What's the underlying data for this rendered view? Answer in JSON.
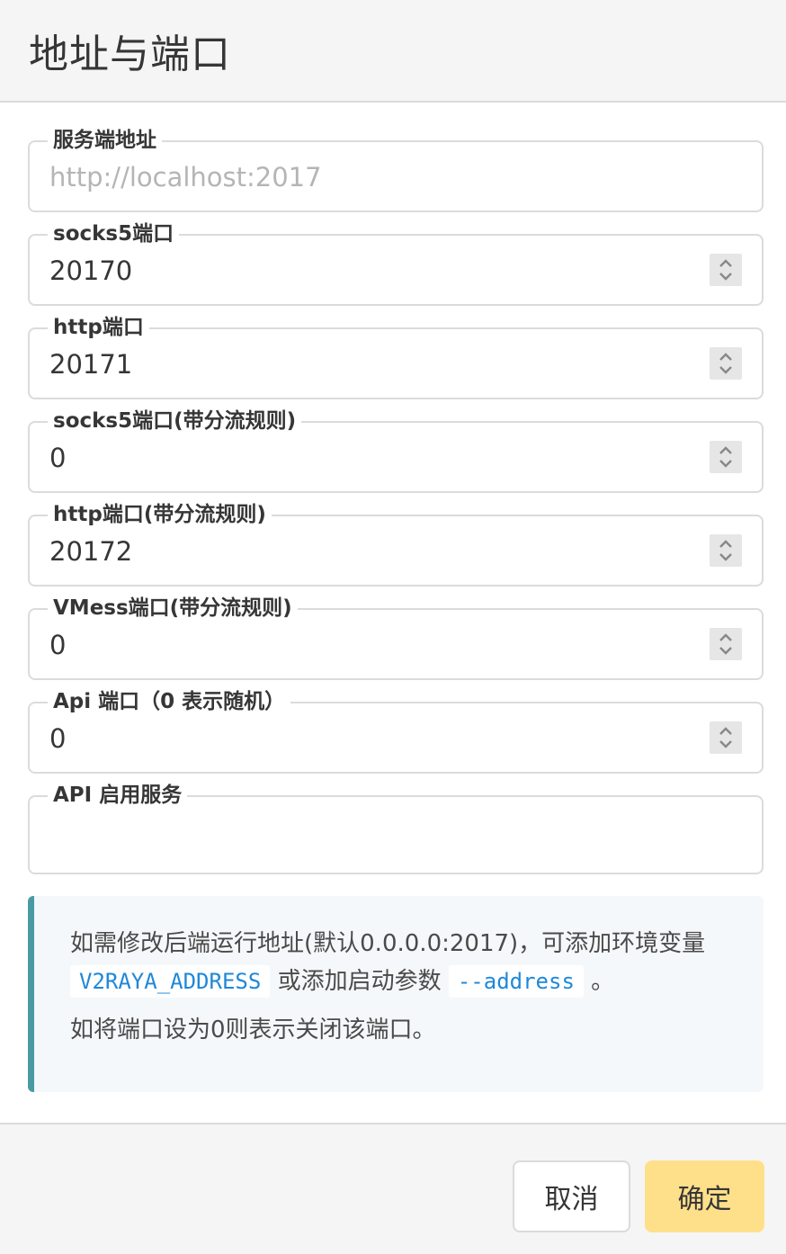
{
  "dialog": {
    "title": "地址与端口"
  },
  "fields": [
    {
      "label": "服务端地址",
      "value": "",
      "placeholder": "http://localhost:2017"
    },
    {
      "label": "socks5端口",
      "value": "20170"
    },
    {
      "label": "http端口",
      "value": "20171"
    },
    {
      "label": "socks5端口(带分流规则)",
      "value": "0"
    },
    {
      "label": "http端口(带分流规则)",
      "value": "20172"
    },
    {
      "label": "VMess端口(带分流规则)",
      "value": "0"
    },
    {
      "label": "Api 端口（0 表示随机）",
      "value": "0"
    },
    {
      "label": "API 启用服务",
      "value": ""
    }
  ],
  "notice": {
    "line1_text": "如需修改后端运行地址(默认0.0.0.0:2017)，可添加环境变量",
    "code1": "V2RAYA_ADDRESS",
    "middle_text": "或添加启动参数",
    "code2": "--address",
    "end_text": "。",
    "line2_text": "如将端口设为0则表示关闭该端口。"
  },
  "footer": {
    "cancel_label": "取消",
    "ok_label": "确定"
  },
  "colors": {
    "accent_button": "#ffe08a",
    "notice_border": "#4a9aa3",
    "code_text": "#1e88d8"
  },
  "icons": {
    "spinner": "chevron-up-down-icon"
  }
}
